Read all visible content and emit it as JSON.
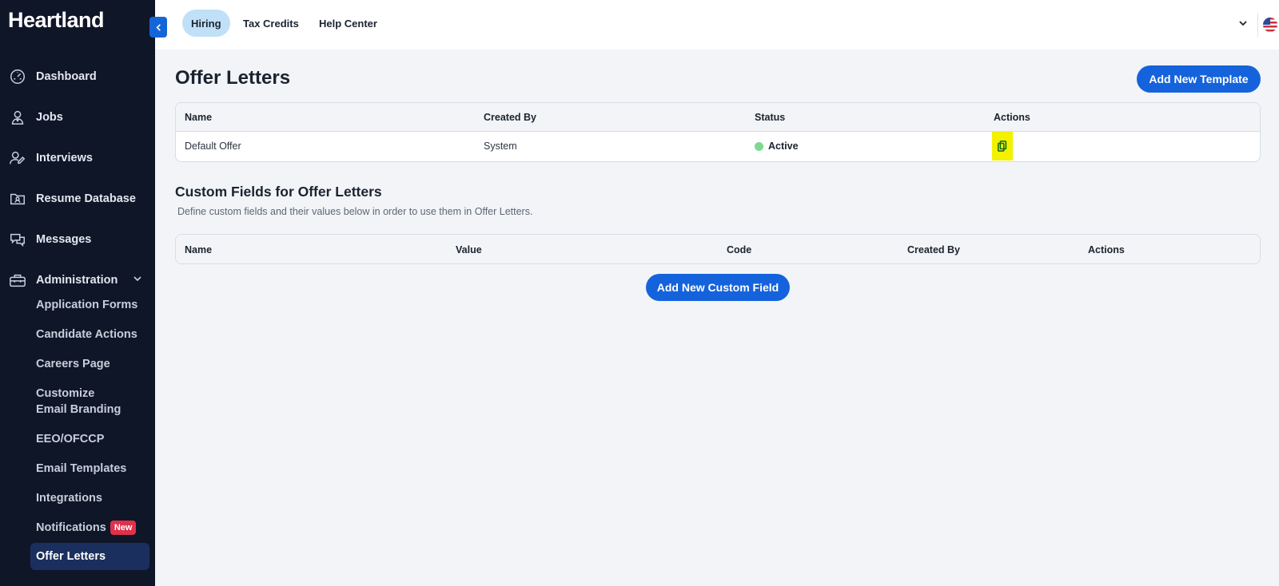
{
  "app": {
    "logo": "Heartland"
  },
  "sidebar": {
    "items": [
      {
        "label": "Dashboard",
        "icon": "dashboard-icon"
      },
      {
        "label": "Jobs",
        "icon": "jobs-icon"
      },
      {
        "label": "Interviews",
        "icon": "interviews-icon"
      },
      {
        "label": "Resume Database",
        "icon": "resume-database-icon"
      },
      {
        "label": "Messages",
        "icon": "messages-icon"
      },
      {
        "label": "Administration",
        "icon": "administration-icon"
      }
    ],
    "admin_subitems": [
      {
        "label": "Application Forms"
      },
      {
        "label": "Candidate Actions"
      },
      {
        "label": "Careers Page"
      },
      {
        "label": "Customize Email Branding"
      },
      {
        "label": "EEO/OFCCP"
      },
      {
        "label": "Email Templates"
      },
      {
        "label": "Integrations"
      },
      {
        "label": "Notifications",
        "badge": "New"
      },
      {
        "label": "Offer Letters",
        "active": true
      }
    ]
  },
  "topbar": {
    "tabs": [
      {
        "label": "Hiring",
        "active": true
      },
      {
        "label": "Tax Credits"
      },
      {
        "label": "Help Center"
      }
    ]
  },
  "page": {
    "title": "Offer Letters",
    "add_template_label": "Add New Template"
  },
  "offer_table": {
    "headers": [
      "Name",
      "Created By",
      "Status",
      "Actions"
    ],
    "rows": [
      {
        "name": "Default Offer",
        "created_by": "System",
        "status": "Active",
        "status_color": "#7fd88f"
      }
    ]
  },
  "custom_fields": {
    "title": "Custom Fields for Offer Letters",
    "description": "Define custom fields and their values below in order to use them in Offer Letters.",
    "headers": [
      "Name",
      "Value",
      "Code",
      "Created By",
      "Actions"
    ],
    "add_label": "Add New Custom Field"
  },
  "colors": {
    "primary": "#1563dc",
    "sidebar_bg": "#0f1628",
    "active_tab_bg": "#bfe0f7",
    "highlight": "#f3f000"
  }
}
